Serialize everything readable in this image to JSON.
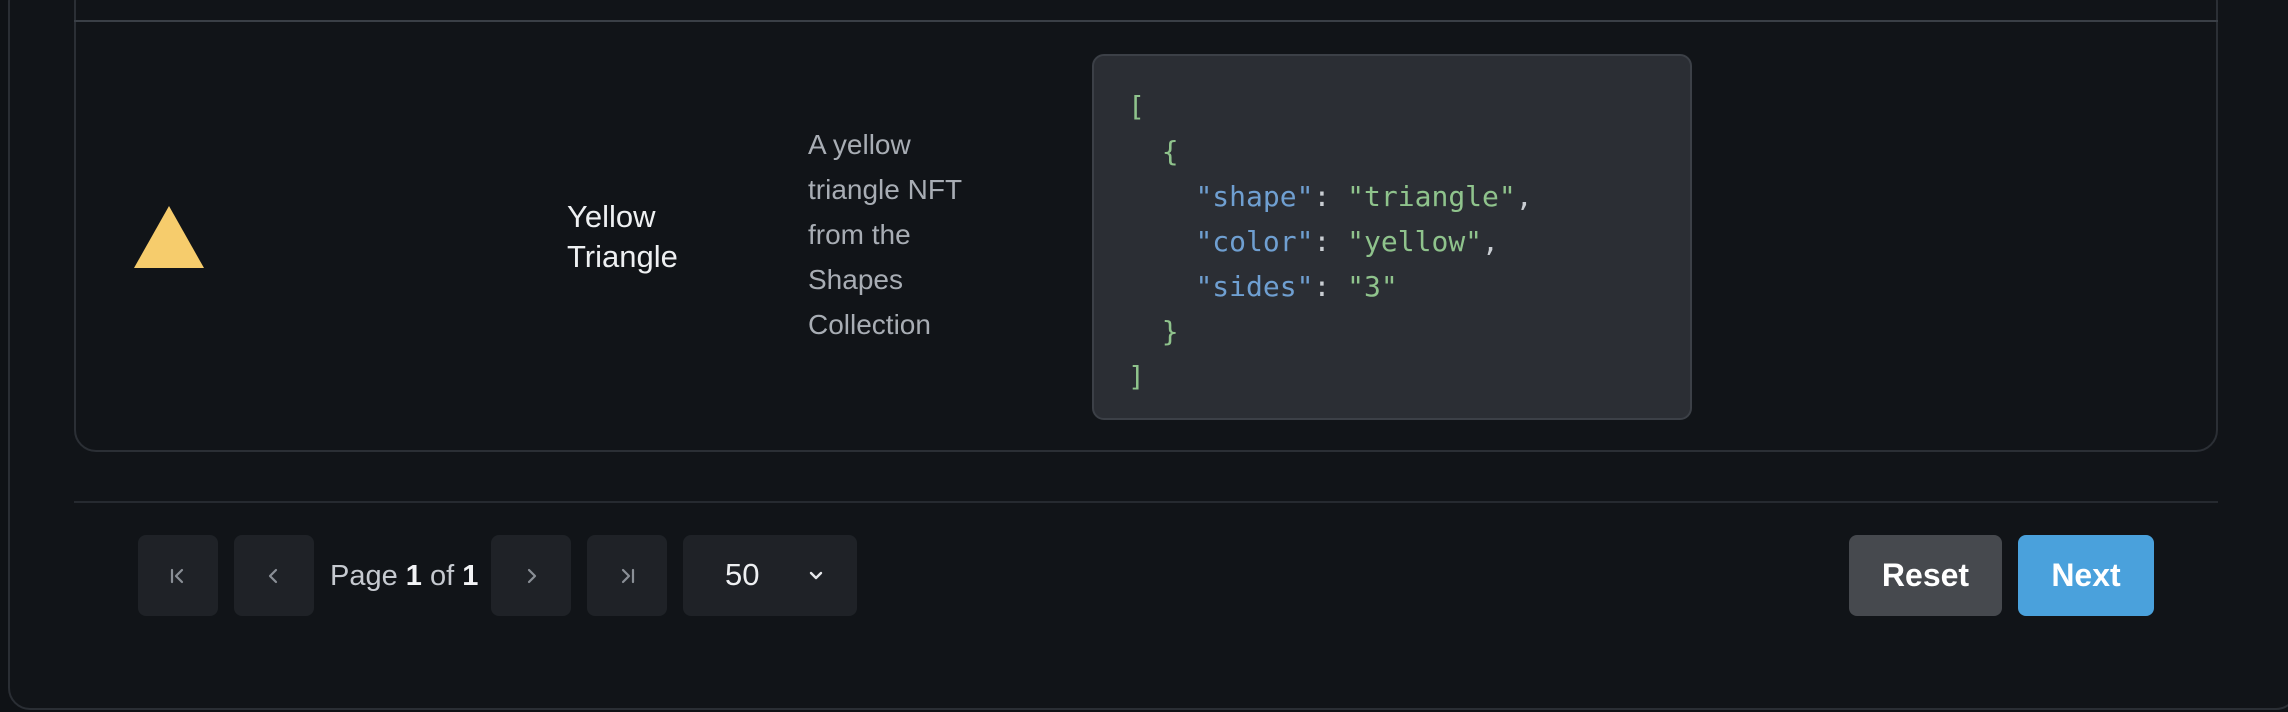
{
  "row": {
    "image_icon": "yellow-triangle-icon",
    "name": "Yellow Triangle",
    "description": "A yellow triangle NFT from the Shapes Collection",
    "attributes": {
      "open_bracket": "[",
      "open_brace": "{",
      "items": [
        {
          "key": "\"shape\"",
          "value": "\"triangle\"",
          "trail": ","
        },
        {
          "key": "\"color\"",
          "value": "\"yellow\"",
          "trail": ","
        },
        {
          "key": "\"sides\"",
          "value": "\"3\"",
          "trail": ""
        }
      ],
      "close_brace": "}",
      "close_bracket": "]"
    }
  },
  "pagination": {
    "page_word": "Page",
    "current": "1",
    "of_word": "of",
    "total": "1",
    "first_icon": "first-page-icon",
    "prev_icon": "chevron-left-icon",
    "next_icon": "chevron-right-icon",
    "last_icon": "last-page-icon",
    "page_size": "50",
    "page_size_icon": "chevron-down-icon"
  },
  "actions": {
    "reset_label": "Reset",
    "next_label": "Next"
  },
  "colors": {
    "background": "#111418",
    "triangle": "#f6cc6c",
    "next_button": "#4aa1dc",
    "reset_button": "#46494e"
  }
}
